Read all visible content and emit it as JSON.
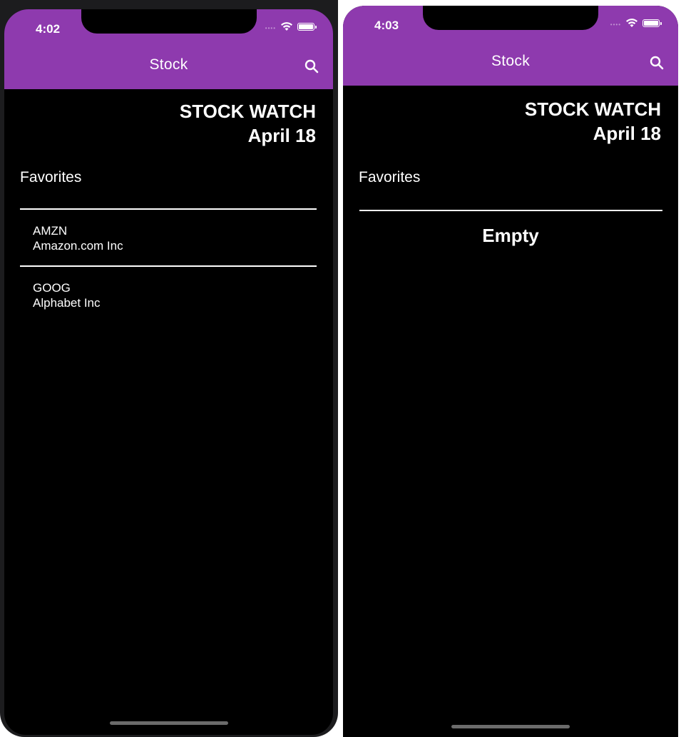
{
  "screens": [
    {
      "status_time": "4:02",
      "app_title": "Stock",
      "header_line1": "STOCK WATCH",
      "header_line2": "April 18",
      "favorites_label": "Favorites",
      "favorites": [
        {
          "symbol": "AMZN",
          "name": "Amazon.com Inc"
        },
        {
          "symbol": "GOOG",
          "name": "Alphabet Inc"
        }
      ]
    },
    {
      "status_time": "4:03",
      "app_title": "Stock",
      "header_line1": "STOCK WATCH",
      "header_line2": "April 18",
      "favorites_label": "Favorites",
      "empty_text": "Empty"
    }
  ],
  "icons": {
    "search": "search-icon",
    "wifi": "wifi-icon",
    "battery": "battery-icon",
    "signal": "signal-dots-icon"
  },
  "colors": {
    "appbar": "#8e3aae",
    "background": "#000000",
    "text": "#ffffff"
  }
}
